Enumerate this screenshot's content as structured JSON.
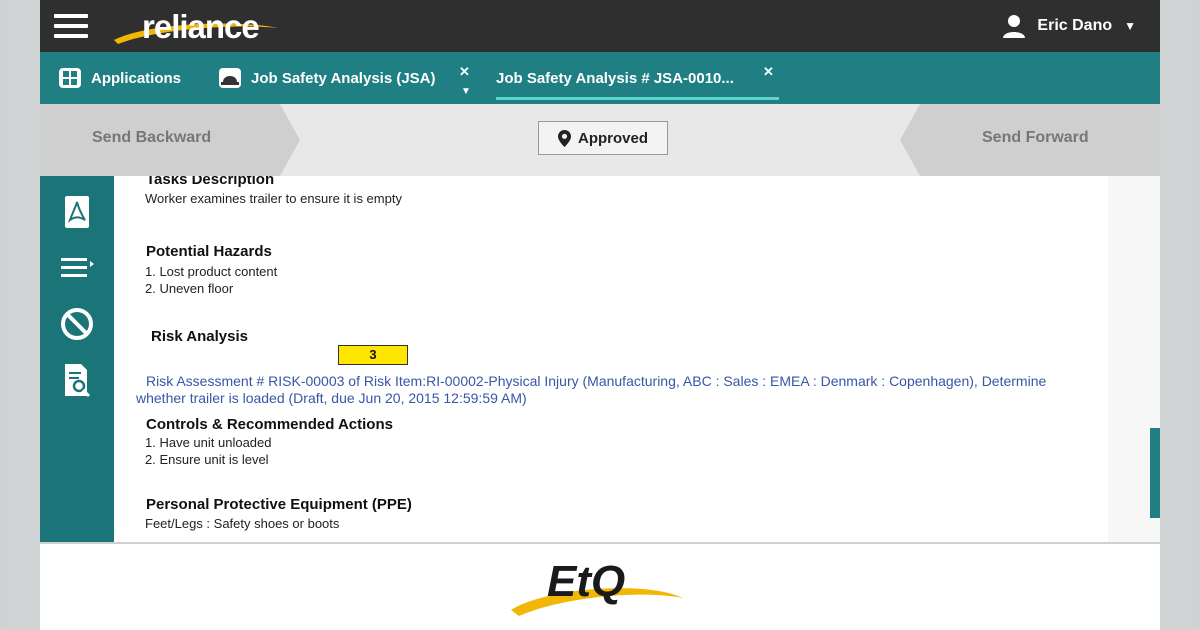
{
  "topbar": {
    "brand": "reliance",
    "user_name": "Eric Dano"
  },
  "tabs": [
    {
      "label": "Applications"
    },
    {
      "label": "Job Safety Analysis (JSA)"
    },
    {
      "label": "Job Safety Analysis # JSA-0010..."
    }
  ],
  "workflow": {
    "back_label": "Send Backward",
    "status_label": "Approved",
    "forward_label": "Send Forward"
  },
  "content": {
    "tasks_heading": "Tasks Description",
    "tasks_text": "Worker examines trailer to ensure it is empty",
    "hazards_heading": "Potential Hazards",
    "hazards": [
      "1. Lost product content",
      "2. Uneven floor"
    ],
    "risk_heading": "Risk Analysis",
    "risk_value": "3",
    "risk_link": "Risk Assessment # RISK-00003 of Risk Item:RI-00002-Physical Injury (Manufacturing, ABC : Sales : EMEA : Denmark : Copenhagen), Determine whether trailer is loaded (Draft, due Jun 20, 2015 12:59:59 AM)",
    "controls_heading": "Controls & Recommended Actions",
    "controls": [
      "1. Have unit unloaded",
      "2. Ensure unit is level"
    ],
    "ppe_heading": "Personal Protective Equipment (PPE)",
    "ppe_text": "Feet/Legs : Safety shoes or boots"
  },
  "footer": {
    "logo_text": "EtQ"
  },
  "colors": {
    "topbar": "#2f2f2f",
    "teal": "#1f7f83",
    "sidebar": "#1a7478",
    "link": "#3856a8",
    "risk_highlight": "#ffe600",
    "brand_gold": "#f2b705"
  },
  "icons": {
    "menu": "hamburger-icon",
    "user": "user-icon",
    "applications": "grid-icon",
    "jsa": "hardhat-icon",
    "status": "location-pin-icon",
    "side": [
      "pdf-icon",
      "list-menu-icon",
      "cancel-icon",
      "search-document-icon"
    ]
  }
}
